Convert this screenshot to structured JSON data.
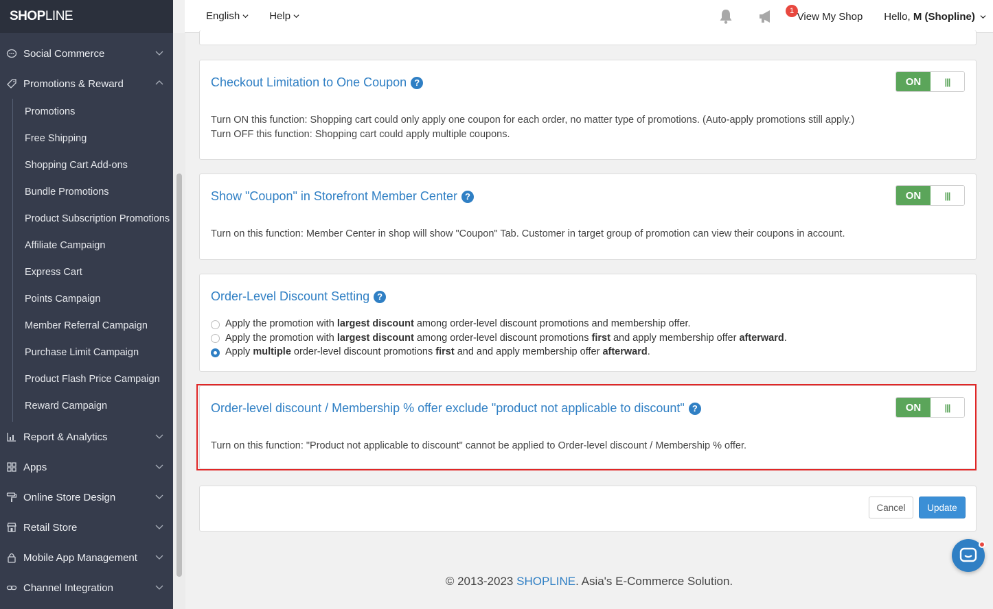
{
  "sidebar": {
    "logo_bold": "SHOP",
    "logo_thin": "LINE",
    "groups_top": [
      {
        "label": "Social Commerce",
        "icon": "chat-bubble-icon"
      },
      {
        "label": "Promotions & Reward",
        "icon": "tag-icon"
      }
    ],
    "sub_items": [
      "Promotions",
      "Free Shipping",
      "Shopping Cart Add-ons",
      "Bundle Promotions",
      "Product Subscription Promotions",
      "Affiliate Campaign",
      "Express Cart",
      "Points Campaign",
      "Member Referral Campaign",
      "Purchase Limit Campaign",
      "Product Flash Price Campaign",
      "Reward Campaign"
    ],
    "groups_bottom": [
      {
        "label": "Report & Analytics",
        "icon": "bar-chart-icon"
      },
      {
        "label": "Apps",
        "icon": "apps-grid-icon"
      },
      {
        "label": "Online Store Design",
        "icon": "paint-roller-icon"
      },
      {
        "label": "Retail Store",
        "icon": "store-icon"
      },
      {
        "label": "Mobile App Management",
        "icon": "lock-icon"
      },
      {
        "label": "Channel Integration",
        "icon": "link-icon"
      }
    ]
  },
  "topbar": {
    "language": "English",
    "help": "Help",
    "notification_count": "1",
    "view_shop": "View My Shop",
    "greeting": "Hello, ",
    "user": "M (Shopline)"
  },
  "cards": {
    "checkout": {
      "title": "Checkout Limitation to One Coupon",
      "toggle": "ON",
      "desc_on": "Turn ON this function: Shopping cart could only apply one coupon for each order, no matter type of promotions. (Auto-apply promotions still apply.)",
      "desc_off": "Turn OFF this function: Shopping cart could apply multiple coupons."
    },
    "coupon": {
      "title": "Show \"Coupon\" in Storefront Member Center",
      "toggle": "ON",
      "desc": "Turn on this function: Member Center in shop will show \"Coupon\" Tab. Customer in target group of promotion can view their coupons in account."
    },
    "order_level": {
      "title": "Order-Level Discount Setting",
      "options": [
        {
          "parts": [
            "Apply the promotion with ",
            "largest discount",
            " among order-level discount promotions and membership offer."
          ],
          "checked": false
        },
        {
          "parts": [
            "Apply the promotion with ",
            "largest discount",
            " among order-level discount promotions ",
            "first",
            " and apply membership offer ",
            "afterward",
            "."
          ],
          "checked": false
        },
        {
          "parts": [
            "Apply ",
            "multiple",
            " order-level discount promotions ",
            "first",
            " and and apply membership offer ",
            "afterward",
            "."
          ],
          "checked": true
        }
      ]
    },
    "exclude": {
      "title": "Order-level discount / Membership % offer exclude \"product not applicable to discount\"",
      "toggle": "ON",
      "desc": "Turn on this function: \"Product not applicable to discount\" cannot be applied to Order-level discount / Membership % offer."
    }
  },
  "actions": {
    "cancel": "Cancel",
    "update": "Update"
  },
  "footer": {
    "prefix": "© 2013-2023 ",
    "brand": "SHOPLINE",
    "suffix": ". Asia's E-Commerce Solution."
  },
  "colors": {
    "accent": "#2f7fc4",
    "toggle_on": "#5ba55a",
    "sidebar_bg": "#363c4c",
    "highlight": "#e02626"
  }
}
